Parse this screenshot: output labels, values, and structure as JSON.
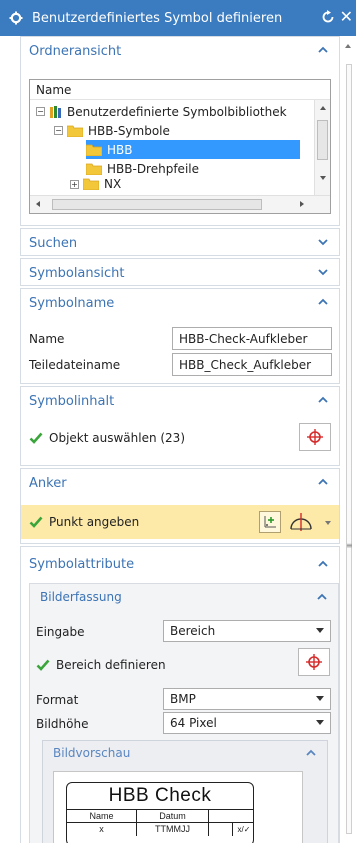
{
  "window": {
    "title": "Benutzerdefiniertes Symbol definieren",
    "reset_icon": "reset-icon",
    "close_glyph": "✕"
  },
  "sections": {
    "ordneransicht": {
      "title": "Ordneransicht",
      "column_header": "Name",
      "tree": [
        {
          "label": "Benutzerdefinierte Symbolbibliothek",
          "expanded": true,
          "level": 0
        },
        {
          "label": "HBB-Symbole",
          "expanded": true,
          "level": 1
        },
        {
          "label": "HBB",
          "selected": true,
          "level": 2
        },
        {
          "label": "HBB-Drehpfeile",
          "level": 2
        },
        {
          "label": "NX",
          "expanded": false,
          "level": 1
        }
      ]
    },
    "suchen": {
      "title": "Suchen"
    },
    "symbolansicht": {
      "title": "Symbolansicht"
    },
    "symbolname": {
      "title": "Symbolname",
      "name_label": "Name",
      "name_value": "HBB-Check-Aufkleber",
      "teiledatei_label": "Teiledateiname",
      "teiledatei_value": "HBB_Check_Aufkleber"
    },
    "symbolinhalt": {
      "title": "Symbolinhalt",
      "select_label": "Objekt auswählen (23)"
    },
    "anker": {
      "title": "Anker",
      "point_label": "Punkt angeben"
    },
    "symbolattribute": {
      "title": "Symbolattribute",
      "bilderfassung": {
        "title": "Bilderfassung",
        "eingabe_label": "Eingabe",
        "eingabe_value": "Bereich",
        "bereich_label": "Bereich definieren",
        "format_label": "Format",
        "format_value": "BMP",
        "hoehe_label": "Bildhöhe",
        "hoehe_value": "64 Pixel"
      },
      "bildvorschau": {
        "title": "Bildvorschau",
        "preview": {
          "heading": "HBB Check",
          "col1": "Name",
          "col2": "Datum",
          "row_x": "x",
          "row_date": "TTMMJJ",
          "row_check": "x/✓"
        }
      }
    }
  },
  "colors": {
    "titlebar": "#3b7bbf",
    "section_title": "#3c74b4",
    "selection": "#3399ff",
    "anchor_highlight": "#fde9a8",
    "check": "#3aa53a",
    "crosshair": "#d62b2b"
  }
}
